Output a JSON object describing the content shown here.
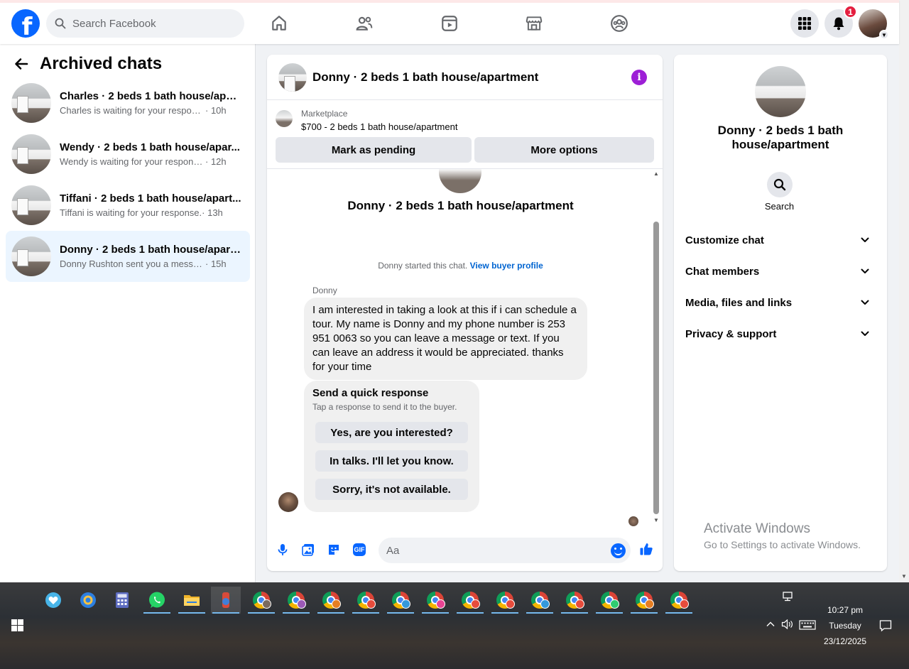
{
  "topbar": {
    "search_placeholder": "Search Facebook",
    "notification_count": "1",
    "logo_letter": "f"
  },
  "sidebar": {
    "title": "Archived chats",
    "chats": [
      {
        "name": "Charles · 2 beds 1 bath house/apar...",
        "message": "Charles is waiting for your response.",
        "time": "· 10h"
      },
      {
        "name": "Wendy · 2 beds 1 bath house/apar...",
        "message": "Wendy is waiting for your response.",
        "time": "· 12h"
      },
      {
        "name": "Tiffani · 2 beds 1 bath house/apart...",
        "message": "Tiffani is waiting for your response.",
        "time": "· 13h"
      },
      {
        "name": "Donny · 2 beds 1 bath house/apart...",
        "message": "Donny Rushton sent you a message ...",
        "time": "· 15h"
      }
    ]
  },
  "chat": {
    "header_title": "Donny · 2 beds 1 bath house/apartment",
    "marketplace_label": "Marketplace",
    "listing": "$700 - 2 beds 1 bath house/apartment",
    "mark_pending": "Mark as pending",
    "more_options": "More options",
    "thread_title": "Donny · 2 beds 1 bath house/apartment",
    "started_text": "Donny started this chat.",
    "buyer_profile_link": "View buyer profile",
    "sender": "Donny",
    "message": "I am interested in taking a look at this if i can schedule a tour. My name is Donny and my phone number is 253 951 0063 so you can leave a message or text.  If you can leave an address it would be appreciated. thanks for your time",
    "quick_title": "Send a quick response",
    "quick_subtitle": "Tap a response to send it to the buyer.",
    "quick_responses": [
      "Yes, are you interested?",
      "In talks. I'll let you know.",
      "Sorry, it's not available."
    ],
    "composer_placeholder": "Aa",
    "gif_label": "GIF"
  },
  "info": {
    "title": "Donny · 2 beds 1 bath house/apartment",
    "search_label": "Search",
    "sections": [
      "Customize chat",
      "Chat members",
      "Media, files and links",
      "Privacy & support"
    ]
  },
  "watermark": {
    "line1": "Activate Windows",
    "line2": "Go to Settings to activate Windows."
  },
  "taskbar": {
    "time": "10:27 pm",
    "day": "Tuesday",
    "date": "23/12/2025",
    "chrome_badges": [
      "#9b59b6",
      "#e67e22",
      "#e74c3c",
      "#3498db",
      "#e84393",
      "#e74c3c",
      "#e74c3c",
      "#3498db",
      "#e74c3c",
      "#2ecc71",
      "#e67e22",
      "#e74c3c"
    ]
  },
  "colors": {
    "brand": "#0866ff",
    "active_chat": "#ebf5ff",
    "info_purple": "#9d1fd6",
    "badge_red": "#e41e3f"
  }
}
